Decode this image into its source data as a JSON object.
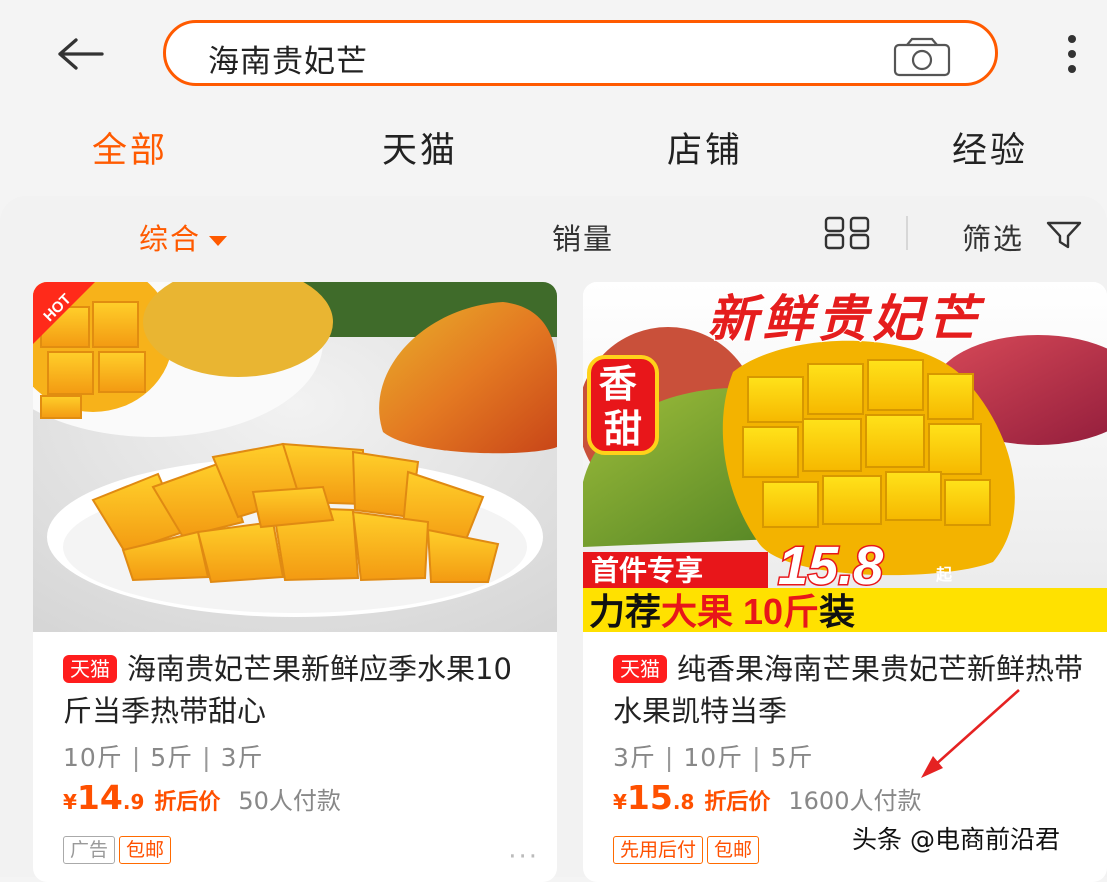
{
  "search": {
    "query": "海南贵妃芒"
  },
  "tabs": [
    {
      "label": "全部",
      "active": true
    },
    {
      "label": "天猫",
      "active": false
    },
    {
      "label": "店铺",
      "active": false
    },
    {
      "label": "经验",
      "active": false
    }
  ],
  "filters": {
    "comprehensive": "综合",
    "sales": "销量",
    "filter": "筛选"
  },
  "products": [
    {
      "image_badge": "HOT",
      "store_badge": "天猫",
      "title": "海南贵妃芒果新鲜应季水果10斤当季热带甜心",
      "specs": [
        "10斤",
        "5斤",
        "3斤"
      ],
      "price_symbol": "¥",
      "price_int": "14",
      "price_dec": ".9",
      "price_note": "折后价",
      "payers": "50人付款",
      "tags": [
        "广告",
        "包邮"
      ],
      "more": "···"
    },
    {
      "banner_title": "新鲜贵妃芒",
      "side_badge": "香甜",
      "promo_label": "首件专享",
      "promo_price": "15.8",
      "promo_suffix": "起",
      "bottom_banner_left": "力荐",
      "bottom_banner_highlight": "大果 10斤",
      "bottom_banner_right": "装",
      "store_badge": "天猫",
      "title": "纯香果海南芒果贵妃芒新鲜热带水果凯特当季",
      "specs": [
        "3斤",
        "10斤",
        "5斤"
      ],
      "price_symbol": "¥",
      "price_int": "15",
      "price_dec": ".8",
      "price_note": "折后价",
      "payers": "1600人付款",
      "tags": [
        "先用后付",
        "包邮"
      ]
    }
  ],
  "watermark": "头条 @电商前沿君",
  "colors": {
    "accent": "#ff5a00",
    "tmall": "#ff1d1d"
  }
}
